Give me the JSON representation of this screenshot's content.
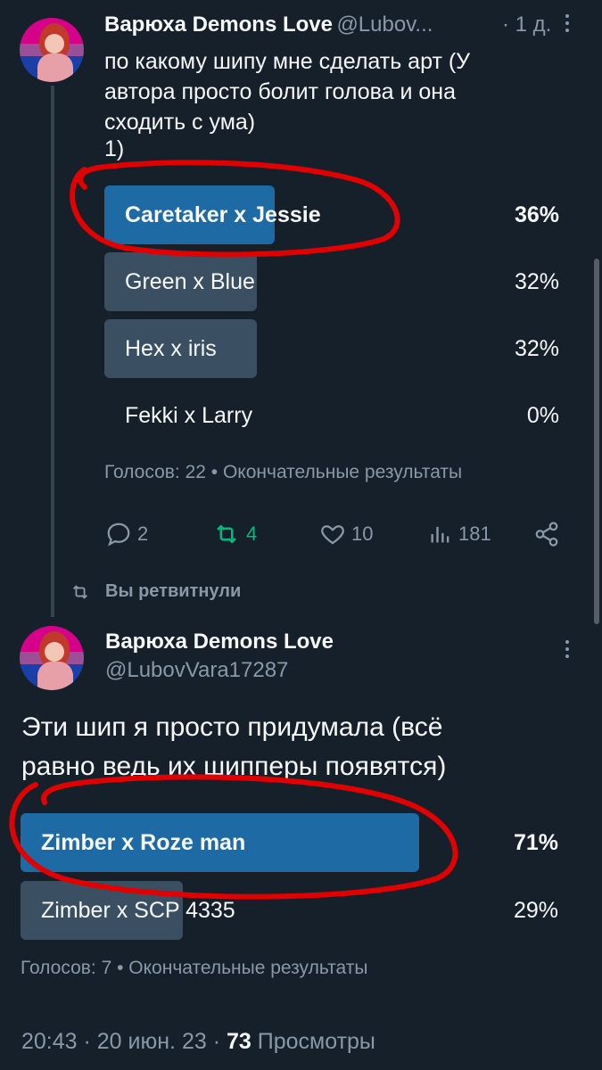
{
  "tweet1": {
    "author_name": "Варюха Demons Love",
    "handle": "@Lubov...",
    "time": "· 1 д.",
    "text_line1": "по какому шипу мне сделать арт (У",
    "text_line2": "автора просто болит голова и она",
    "text_line3": "сходить с ума)",
    "text_line4": "1)",
    "poll": [
      {
        "label": "Caretaker x Jessie",
        "percent": "36%",
        "fraction": 0.36,
        "winner": true
      },
      {
        "label": "Green x Blue",
        "percent": "32%",
        "fraction": 0.32,
        "winner": false
      },
      {
        "label": "Hex x iris",
        "percent": "32%",
        "fraction": 0.32,
        "winner": false
      },
      {
        "label": "Fekki x Larry",
        "percent": "0%",
        "fraction": 0.0,
        "winner": false
      }
    ],
    "poll_meta": "Голосов: 22 • Окончательные результаты",
    "actions": {
      "replies": "2",
      "retweets": "4",
      "likes": "10",
      "views": "181"
    }
  },
  "retweet_banner": "Вы ретвитнули",
  "tweet2": {
    "author_name": "Варюха Demons Love",
    "handle": "@LubovVara17287",
    "text_line1": "Эти шип я просто придумала (всё",
    "text_line2": "равно ведь их шипперы появятся)",
    "poll": [
      {
        "label": "Zimber x Roze man",
        "percent": "71%",
        "fraction": 0.71,
        "winner": true
      },
      {
        "label": "Zimber x SCP 4335",
        "percent": "29%",
        "fraction": 0.29,
        "winner": false
      }
    ],
    "poll_meta": "Голосов: 7 • Окончательные результаты",
    "footer_time": "20:43 · 20 июн. 23 ·",
    "footer_views_count": "73",
    "footer_views_label": "Просмотры"
  },
  "colors": {
    "background": "#15202b",
    "winner_bar": "#1d6aa5",
    "bar": "#3a4f62",
    "retweet_green": "#00ba7c",
    "annotation_red": "#e00000"
  },
  "icons": [
    "reply-icon",
    "retweet-icon",
    "like-icon",
    "views-icon",
    "share-icon",
    "more-icon"
  ]
}
